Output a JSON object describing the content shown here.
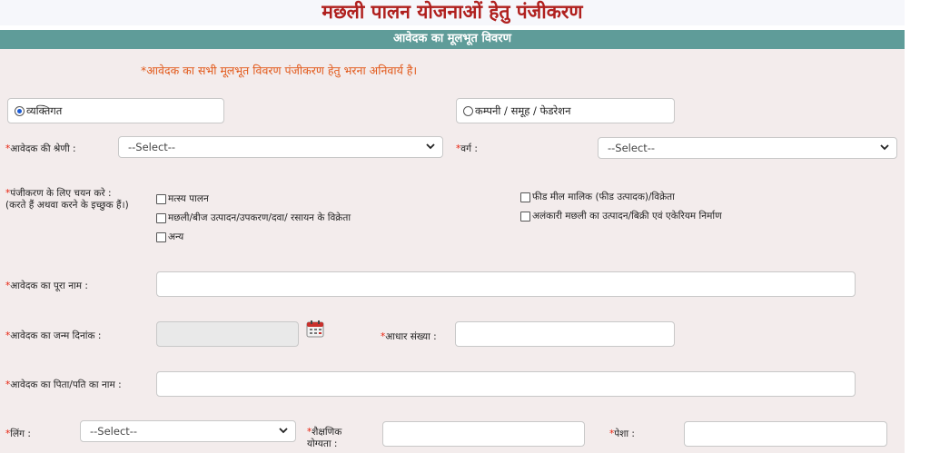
{
  "page": {
    "title": "मछली पालन योजनाओं हेतु पंजीकरण"
  },
  "section": {
    "title": "आवेदक का मूलभूत विवरण"
  },
  "notice": "*आवेदक का सभी मूलभूत विवरण पंजीकरण हेतु भरना अनिवार्य है।",
  "applicant_type": {
    "individual": "व्यक्तिगत",
    "company": "कम्पनी / समूह / फेडरेशन",
    "selected": "individual"
  },
  "category": {
    "label": "आवेदक की श्रेणी :",
    "value": "--Select--"
  },
  "varg": {
    "label": "वर्ग :",
    "value": "--Select--"
  },
  "registration": {
    "label_line1": "पंजीकरण के लिए चयन करे :",
    "label_line2": "(करते हैं अथवा करने के इच्छुक हैं।)",
    "options": [
      "मत्स्य पालन",
      "मछली/बीज उत्पादन/उपकरण/दवा/ रसायन के विक्रेता",
      "अन्य",
      "फीड मील मालिक (फीड उत्पादक)/विक्रेता",
      "अलंकारी मछली का उत्पादन/बिक्री एवं एकेरियम निर्माण"
    ]
  },
  "full_name": {
    "label": "आवेदक का पूरा नाम :",
    "value": ""
  },
  "dob": {
    "label": "आवेदक का जन्म दिनांक :",
    "value": ""
  },
  "aadhar": {
    "label": "आधार संख्या :",
    "value": ""
  },
  "father_name": {
    "label": "आवेदक का पिता/पति का नाम :",
    "value": ""
  },
  "gender": {
    "label": "लिंग :",
    "value": "--Select--"
  },
  "education": {
    "label_line1": "शैक्षणिक",
    "label_line2": "योग्यता :",
    "value": ""
  },
  "occupation": {
    "label": "पेशा :",
    "value": ""
  },
  "colors": {
    "title": "#b0201e",
    "bar": "#5f9c99",
    "required": "#e8200c",
    "notice": "#e2591a"
  },
  "icons": {
    "select_arrow": "chevron-down-icon",
    "calendar": "calendar-icon"
  }
}
